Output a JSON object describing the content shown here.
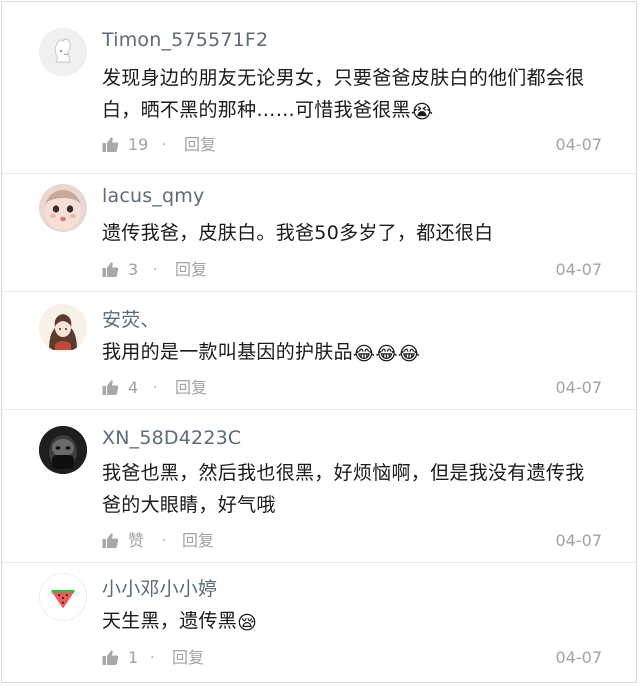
{
  "comments": [
    {
      "username": "Timon_575571F2",
      "text": "发现身边的朋友无论男女，只要爸爸皮肤白的他们都会很白，晒不黑的那种……可惜我爸很黑",
      "emoji": "😭",
      "likes": "19",
      "reply": "回复",
      "date": "04-07",
      "avatar": "default-rabbit-avatar"
    },
    {
      "username": "lacus_qmy",
      "text": "遗传我爸，皮肤白。我爸50多岁了，都还很白",
      "emoji": "",
      "likes": "3",
      "reply": "回复",
      "date": "04-07",
      "avatar": "girl-face-avatar"
    },
    {
      "username": "安荧、",
      "text": "我用的是一款叫基因的护肤品",
      "emoji": "😂😂😂",
      "likes": "4",
      "reply": "回复",
      "date": "04-07",
      "avatar": "illustrated-girl-avatar"
    },
    {
      "username": "XN_58D4223C",
      "text": "我爸也黑，然后我也很黑，好烦恼啊，但是我没有遗传我爸的大眼睛，好气哦",
      "emoji": "",
      "likes": "赞",
      "reply": "回复",
      "date": "04-07",
      "avatar": "dark-face-avatar"
    },
    {
      "username": "小小邓小小婷",
      "text": "天生黑，遗传黑",
      "emoji": "😪",
      "likes": "1",
      "reply": "回复",
      "date": "04-07",
      "avatar": "watermelon-avatar"
    }
  ],
  "colors": {
    "username": "#5c6b7a",
    "text": "#1a1a1a",
    "meta": "#a3a3a3",
    "divider": "#ececec"
  }
}
